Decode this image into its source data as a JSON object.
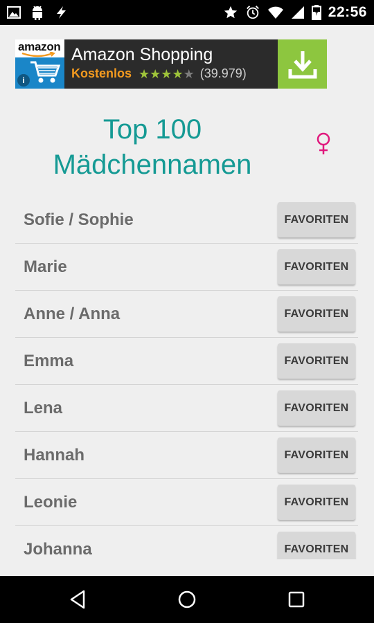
{
  "status_bar": {
    "left_icons": [
      "image-icon",
      "android-icon",
      "flash-icon"
    ],
    "right_icons": [
      "star-icon",
      "alarm-icon",
      "wifi-icon",
      "signal-icon",
      "battery-icon"
    ],
    "time": "22:56"
  },
  "ad": {
    "brand": "amazon",
    "title": "Amazon Shopping",
    "subtitle": "Kostenlos",
    "rating_stars": 4.5,
    "rating_count": "(39.979)",
    "info_label": "i",
    "colors": {
      "panel": "#2b2b2b",
      "download_bg": "#8dc63f",
      "free_text": "#f39a1f",
      "logo_blue": "#1a86c8"
    }
  },
  "header": {
    "title_line1": "Top 100",
    "title_line2": "Mädchennamen",
    "icon": "female-symbol-icon",
    "title_color": "#159a94",
    "icon_color": "#e0197d"
  },
  "names": [
    {
      "name": "Sofie / Sophie",
      "button": "FAVORITEN"
    },
    {
      "name": "Marie",
      "button": "FAVORITEN"
    },
    {
      "name": "Anne / Anna",
      "button": "FAVORITEN"
    },
    {
      "name": "Emma",
      "button": "FAVORITEN"
    },
    {
      "name": "Lena",
      "button": "FAVORITEN"
    },
    {
      "name": "Hannah",
      "button": "FAVORITEN"
    },
    {
      "name": "Leonie",
      "button": "FAVORITEN"
    },
    {
      "name": "Johanna",
      "button": "FAVORITEN"
    }
  ],
  "nav_bar": {
    "buttons": [
      "back-icon",
      "home-icon",
      "recents-icon"
    ]
  }
}
